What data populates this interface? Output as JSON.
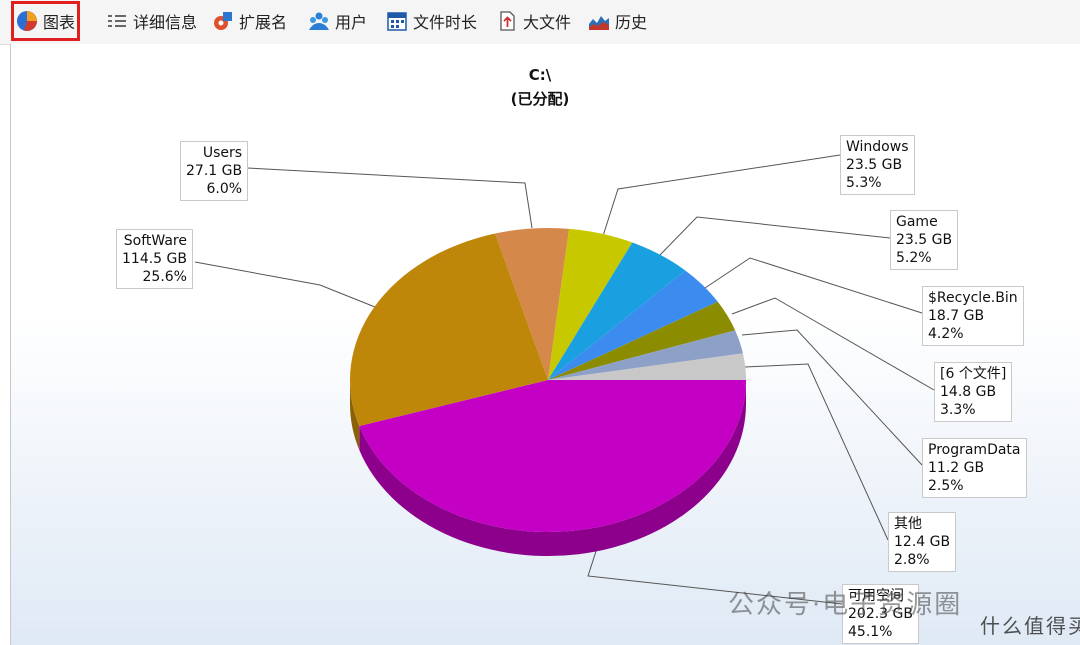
{
  "toolbar": {
    "tabs": [
      {
        "label": "图表",
        "icon": "pie-chart-icon"
      },
      {
        "label": "详细信息",
        "icon": "details-list-icon"
      },
      {
        "label": "扩展名",
        "icon": "extension-icon"
      },
      {
        "label": "用户",
        "icon": "users-icon"
      },
      {
        "label": "文件时长",
        "icon": "calendar-icon"
      },
      {
        "label": "大文件",
        "icon": "big-file-icon"
      },
      {
        "label": "历史",
        "icon": "history-icon"
      }
    ],
    "active_tab": "图表"
  },
  "chart_data": {
    "type": "pie",
    "title": "C:\\",
    "subtitle": "(已分配)",
    "slices": [
      {
        "name": "可用空间",
        "size": "202.3 GB",
        "pct": 45.1,
        "pct_label": "45.1%",
        "color": "#c300c3"
      },
      {
        "name": "SoftWare",
        "size": "114.5 GB",
        "pct": 25.6,
        "pct_label": "25.6%",
        "color": "#bf870a"
      },
      {
        "name": "Users",
        "size": "27.1 GB",
        "pct": 6.0,
        "pct_label": "6.0%",
        "color": "#d4884a"
      },
      {
        "name": "Windows",
        "size": "23.5 GB",
        "pct": 5.3,
        "pct_label": "5.3%",
        "color": "#c8c800"
      },
      {
        "name": "Game",
        "size": "23.5 GB",
        "pct": 5.2,
        "pct_label": "5.2%",
        "color": "#1aa0e0"
      },
      {
        "name": "$Recycle.Bin",
        "size": "18.7 GB",
        "pct": 4.2,
        "pct_label": "4.2%",
        "color": "#3c8cf0"
      },
      {
        "name": "[6 个文件]",
        "size": "14.8 GB",
        "pct": 3.3,
        "pct_label": "3.3%",
        "color": "#8c8c00"
      },
      {
        "name": "ProgramData",
        "size": "11.2 GB",
        "pct": 2.5,
        "pct_label": "2.5%",
        "color": "#8ca0c8"
      },
      {
        "name": "其他",
        "size": "12.4 GB",
        "pct": 2.8,
        "pct_label": "2.8%",
        "color": "#c8c8c8"
      }
    ]
  },
  "watermark": {
    "text": "公众号·电子资源圈",
    "site": "什么值得买"
  }
}
